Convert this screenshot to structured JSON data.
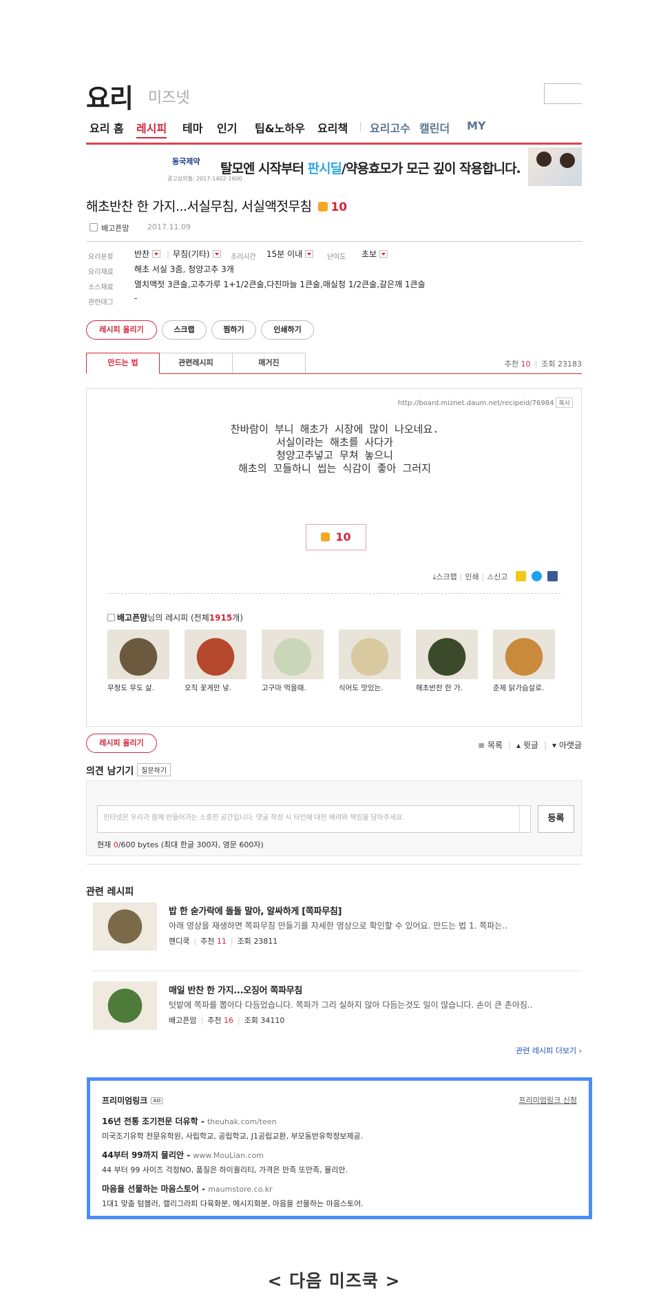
{
  "header": {
    "logo": "요리",
    "logo_sub": "미즈넷"
  },
  "nav": [
    {
      "label": "요리 홈"
    },
    {
      "label": "레시피"
    },
    {
      "label": "테마"
    },
    {
      "label": "인기"
    },
    {
      "label": "팁&노하우"
    },
    {
      "label": "요리책"
    },
    {
      "label": "요리고수"
    },
    {
      "label": "캘린더"
    },
    {
      "label": "MY"
    }
  ],
  "banner": {
    "brand": "동국제약",
    "text_pre": "탈모엔 시작부터 ",
    "text_em": "판시딜",
    "text_post": "/약용효모가 모근 깊이 작용합니다.",
    "approval": "광고심의필: 2017-1402-1600"
  },
  "recipe": {
    "title": "해초반찬 한 가지...서실무침, 서실액젓무침",
    "recommend": "10",
    "author": "배고픈맘",
    "date": "2017.11.09",
    "category_label": "요리분류",
    "category1": "반찬",
    "category2": "무침(기타)",
    "time_label": "조리시간",
    "time": "15분 이내",
    "difficulty_label": "난이도",
    "difficulty": "초보",
    "ingredients_label": "요리재료",
    "ingredients": "해초 서실 3줌, 청양고추 3개",
    "sauce_label": "소스재료",
    "sauce": "멸치액젓 3큰술,고추가루 1+1/2큰술,다진마늘 1큰술,매실청 1/2큰술,갈은깨 1큰술",
    "tags_label": "관련태그",
    "tags": "-"
  },
  "buttons": {
    "upload": "레시피 올리기",
    "scrap": "스크랩",
    "bookmark": "찜하기",
    "print": "인쇄하기"
  },
  "tabs": [
    {
      "label": "만드는 법"
    },
    {
      "label": "관련레시피"
    },
    {
      "label": "매거진"
    }
  ],
  "stats": {
    "rec_label": "추천",
    "rec": "10",
    "view_label": "조회",
    "views": "23183"
  },
  "content": {
    "url": "http://board.miznet.daum.net/recipeid/76984",
    "copy_label": "복사",
    "story": [
      "찬바람이 부니 해초가 시장에 많이 나오네요.",
      "서실이라는 해초를 사다가",
      "청양고추넣고 무쳐 놓으니",
      "해초의 꼬들하니 씹는 식감이 좋아 그러지"
    ],
    "recommend_box": "10",
    "share": {
      "scrap": "스크랩",
      "print": "인쇄",
      "report": "신고"
    }
  },
  "more_recipes": {
    "author": "배고픈맘",
    "label_mid": "님의 레시피 (전체",
    "count": "1915",
    "label_end": "개)",
    "items": [
      {
        "caption": "무청도 무도 삶.",
        "color": "#6b5a3e"
      },
      {
        "caption": "오직 꽃게만 넣.",
        "color": "#b5482c"
      },
      {
        "caption": "고구마 먹을때.",
        "color": "#c9d6b8"
      },
      {
        "caption": "식어도 맛있는.",
        "color": "#d9c9a0"
      },
      {
        "caption": "해초반찬 한 가.",
        "color": "#3b4a2a"
      },
      {
        "caption": "춘제 닭가슴살로.",
        "color": "#c98a3c"
      }
    ]
  },
  "list_nav": {
    "list": "목록",
    "prev": "윗글",
    "next": "아랫글"
  },
  "opinion": {
    "title": "의견 남기기",
    "ask": "질문하기",
    "placeholder": "인터넷은 우리가 함께 만들어가는 소중한 공간입니다. 댓글 작성 시 타인에 대한 배려와 책임을 담아주세요.",
    "register": "등록",
    "bytes_pre": "현재 ",
    "bytes_now": "0",
    "bytes_post": "/600 bytes (최대 한글 300자, 영문 600자)"
  },
  "related": {
    "title": "관련 레시피",
    "items": [
      {
        "title": "밥 한 숟가락에 돌돌 말아, 알싸하게 [쪽파무침]",
        "desc": "아래 영상을 재생하면 쪽파무침 만들기를 자세한 영상으로 확인할 수 있어요. 만드는 법 1. 쪽파는..",
        "author": "핸디쿡",
        "rec_label": "추천",
        "rec": "11",
        "view_label": "조회",
        "views": "23811",
        "color": "#7a6a4a"
      },
      {
        "title": "매일 반찬 한 가지...오징어 쪽파무침",
        "desc": "텃밭에 쪽파를 뽑아다 다듬었습니다. 쪽파가 그리 실하지 않아 다듬는것도 일이 많습니다. 손이 큰 촌아짐..",
        "author": "배고픈맘",
        "rec_label": "추천",
        "rec": "16",
        "view_label": "조회",
        "views": "34110",
        "color": "#4e7a3a"
      }
    ],
    "more": "관련 레시피 더보기 ›"
  },
  "premium": {
    "title": "프리미엄링크",
    "ad": "AD",
    "apply": "프리미엄링크 신청",
    "items": [
      {
        "title": "16년 전통 조기전문 더유학",
        "url": "theuhak.com/teen",
        "desc": "미국조기유학 전문유학원, 사립학교, 공립학교, J1공립교환, 부모동반유학정보제공."
      },
      {
        "title": "44부터 99까지 뮬리안",
        "url": "www.MouLian.com",
        "desc": "44 부터 99 사이즈 걱정NO, 품질은 하이퀄리티, 가격은 만족 또만족, 뮬리안."
      },
      {
        "title": "마음을 선물하는 마음스토어",
        "url": "maumstore.co.kr",
        "desc": "1대1 맞춤 텀블러, 캘리그라피 다육화분, 메시지화분, 마음을 선물하는 마음스토어."
      }
    ]
  },
  "footer": {
    "label": "< 다음 미즈쿡 >"
  }
}
